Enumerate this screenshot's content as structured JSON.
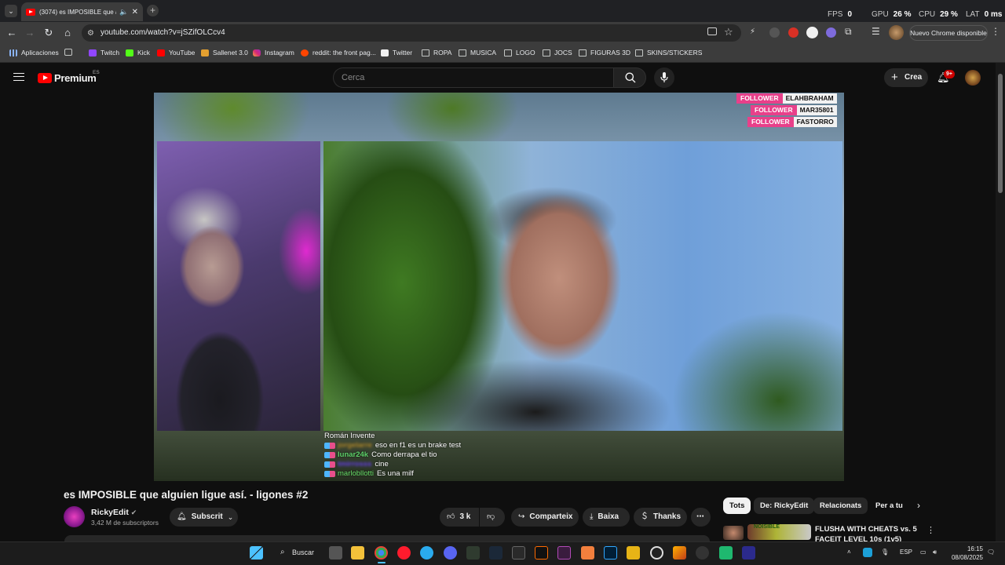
{
  "browser": {
    "tab_title": "(3074) es IMPOSIBLE que al...",
    "url": "youtube.com/watch?v=jSZifOLCcv4",
    "update_label": "Nuevo Chrome disponible",
    "perf": [
      {
        "label": "FPS",
        "value": "0"
      },
      {
        "label": "GPU",
        "value": "26 %"
      },
      {
        "label": "CPU",
        "value": "29 %"
      },
      {
        "label": "LAT",
        "value": "0 ms"
      }
    ],
    "bookmarks": [
      "Aplicaciones",
      "Twitch",
      "Kick",
      "YouTube",
      "Sallenet 3.0",
      "Instagram",
      "reddit: the front pag...",
      "Twitter",
      "ROPA",
      "MUSICA",
      "LOGO",
      "JOCS",
      "FIGURAS 3D",
      "SKINS/STICKERS"
    ]
  },
  "youtube": {
    "logo_text": "Premium",
    "region": "ES",
    "search_placeholder": "Cerca",
    "create_label": "Crea",
    "notif_count": "9+"
  },
  "video": {
    "followers": [
      {
        "label": "FOLLOWER",
        "name": "ELAHBRAHAM"
      },
      {
        "label": "FOLLOWER",
        "name": "MAR35801"
      },
      {
        "label": "FOLLOWER",
        "name": "FASTORRO"
      }
    ],
    "chat": [
      {
        "user": "Román Invente",
        "text": ""
      },
      {
        "user": "jorgelarre",
        "text": "eso en f1 es un brake test"
      },
      {
        "user": "lunar24k",
        "text": "Como derrapa el tio"
      },
      {
        "user": "tmirrosss",
        "text": "cine"
      },
      {
        "user": "marlobllotti",
        "text": "Es una milf"
      }
    ]
  },
  "watch": {
    "title": "es IMPOSIBLE que alguien ligue así. - ligones #2",
    "channel": "RickyEdit",
    "subscribers": "3,42 M de subscriptors",
    "subscribe_label": "Subscrit",
    "likes": "3 k",
    "share_label": "Comparteix",
    "download_label": "Baixa",
    "thanks_label": "Thanks"
  },
  "sidebar": {
    "chips": [
      "Tots",
      "De: RickyEdit",
      "Relacionats",
      "Per a tu"
    ],
    "rec_title": "FLUSHA WITH CHEATS vs. 5",
    "rec_title_2": "FACEIT LEVEL 10s (1v5)",
    "rec_thumb_text": "NOISIBLE"
  },
  "taskbar": {
    "search_label": "Buscar",
    "lang": "ESP",
    "time": "16:15",
    "date": "08/08/2025"
  }
}
